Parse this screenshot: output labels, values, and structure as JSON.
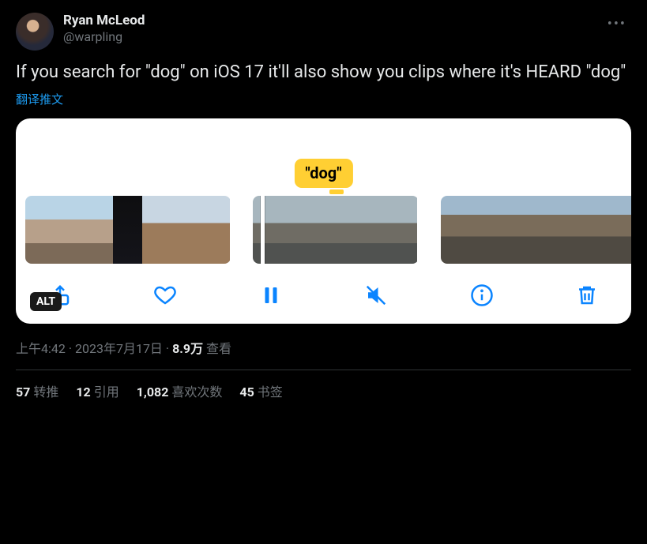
{
  "author": {
    "display_name": "Ryan McLeod",
    "handle": "@warpling"
  },
  "tweet_text": "If you search for \"dog\" on iOS 17 it'll also show you clips where it's HEARD \"dog\"",
  "translate_label": "翻译推文",
  "media": {
    "caption_bubble": "\"dog\"",
    "alt_badge": "ALT"
  },
  "meta": {
    "time": "上午4:42",
    "date": "2023年7月17日",
    "views_count": "8.9万",
    "views_label": "查看"
  },
  "stats": {
    "retweets": {
      "count": "57",
      "label": "转推"
    },
    "quotes": {
      "count": "12",
      "label": "引用"
    },
    "likes": {
      "count": "1,082",
      "label": "喜欢次数"
    },
    "bookmarks": {
      "count": "45",
      "label": "书签"
    }
  }
}
